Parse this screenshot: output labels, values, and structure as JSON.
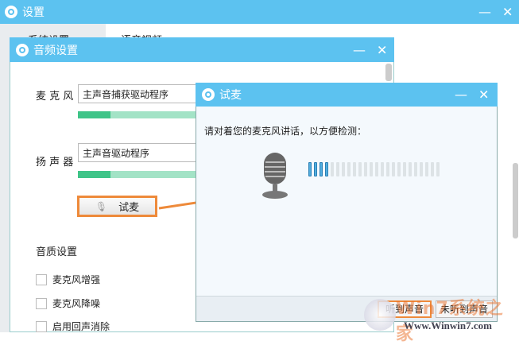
{
  "main": {
    "title": "设置",
    "sidebar_item": "系统设置",
    "content_tab": "语音视频",
    "minimize": "—",
    "close": "✕"
  },
  "audio": {
    "title": "音频设置",
    "minimize": "—",
    "close": "✕",
    "mic_label": "麦 克 风",
    "mic_device": "主声音捕获驱动程序",
    "mic_level_percent": 18,
    "speaker_label": "扬 声 器",
    "speaker_device": "主声音驱动程序",
    "speaker_level_percent": 18,
    "test_button": "试麦",
    "quality_title": "音质设置",
    "options": [
      {
        "label": "麦克风增强",
        "checked": false
      },
      {
        "label": "麦克风降噪",
        "checked": false
      },
      {
        "label": "启用回声消除",
        "checked": false
      }
    ]
  },
  "test": {
    "title": "试麦",
    "minimize": "—",
    "close": "✕",
    "prompt": "请对着您的麦克风讲话，以方便检测：",
    "meter_total_segments": 24,
    "meter_active_segments": 4,
    "heard_button": "听到声音",
    "not_heard_button": "未听到声音"
  },
  "watermark": {
    "brand": "Win7系统之家",
    "url": "Www.Winwin7.com"
  },
  "colors": {
    "titlebar": "#5cc2f0",
    "accent": "#ee8a3a",
    "level": "#3fc488"
  }
}
